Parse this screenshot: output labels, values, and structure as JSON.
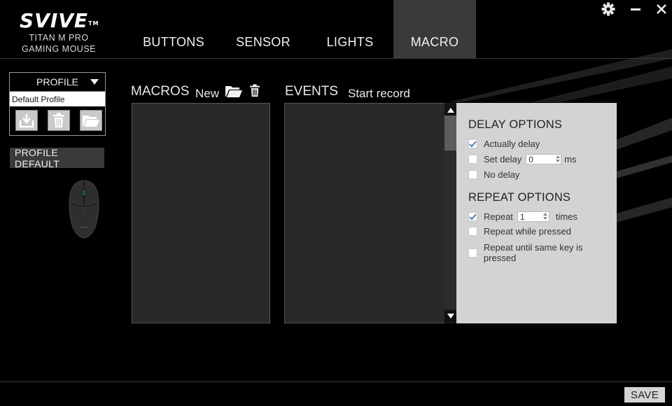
{
  "brand": {
    "logo": "SVIVE",
    "trademark": "TM",
    "model": "TITAN M PRO",
    "subtitle": "GAMING MOUSE"
  },
  "tabs": [
    {
      "label": "BUTTONS",
      "active": false
    },
    {
      "label": "SENSOR",
      "active": false
    },
    {
      "label": "LIGHTS",
      "active": false
    },
    {
      "label": "MACRO",
      "active": true
    }
  ],
  "window_controls": {
    "settings_icon": "gear-icon",
    "minimize_icon": "minimize-icon",
    "close_icon": "close-icon"
  },
  "profile": {
    "header_label": "PROFILE",
    "selected": "Default Profile",
    "buttons": [
      "import-icon",
      "trash-icon",
      "folder-open-icon"
    ],
    "default_label": "PROFILE DEFAULT"
  },
  "macros": {
    "title": "MACROS",
    "new_label": "New",
    "open_icon": "folder-open-icon",
    "delete_icon": "trash-icon",
    "items": []
  },
  "events": {
    "title": "EVENTS",
    "record_label": "Start record",
    "items": []
  },
  "delay_options": {
    "title": "DELAY OPTIONS",
    "actually_delay": {
      "label": "Actually delay",
      "checked": true
    },
    "set_delay": {
      "label": "Set delay",
      "checked": false,
      "value": "0",
      "unit": "ms"
    },
    "no_delay": {
      "label": "No delay",
      "checked": false
    }
  },
  "repeat_options": {
    "title": "REPEAT OPTIONS",
    "repeat": {
      "label": "Repeat",
      "checked": true,
      "value": "1",
      "unit": "times"
    },
    "repeat_while_pressed": {
      "label": "Repeat while pressed",
      "checked": false
    },
    "repeat_until_same_key": {
      "label": "Repeat until same key is pressed",
      "checked": false
    }
  },
  "footer": {
    "save_label": "SAVE"
  },
  "colors": {
    "background": "#000000",
    "active_tab": "#3a3a3a",
    "panel": "#292929",
    "options_panel": "#d3d3d3",
    "check_accent": "#4a7fc1"
  }
}
